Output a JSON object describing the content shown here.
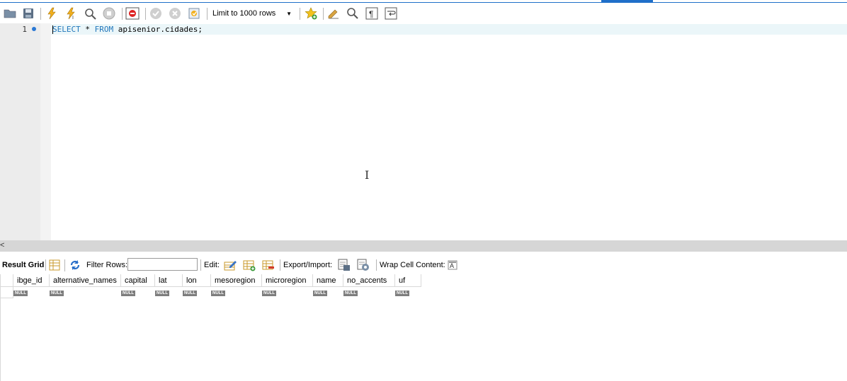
{
  "toolbar": {
    "limit_label": "Limit to 1000 rows",
    "icons": [
      "open-folder-icon",
      "save-icon",
      "execute-icon",
      "execute-current-icon",
      "explain-icon",
      "stop-icon",
      "toggle-error-icon",
      "commit-icon",
      "rollback-icon",
      "autocommit-icon",
      "bookmark-star-icon",
      "beautify-icon",
      "find-icon",
      "invisible-chars-icon",
      "wrap-lines-icon"
    ]
  },
  "editor": {
    "line_number": "1",
    "code": {
      "kw_select": "SELECT",
      "star": " * ",
      "kw_from": "FROM",
      "rest": " apisenior.cidades;"
    }
  },
  "result_toolbar": {
    "result_grid": "Result Grid",
    "filter_rows": "Filter Rows:",
    "edit": "Edit:",
    "export_import": "Export/Import:",
    "wrap_cell": "Wrap Cell Content:"
  },
  "grid": {
    "columns": [
      "ibge_id",
      "alternative_names",
      "capital",
      "lat",
      "lon",
      "mesoregion",
      "microregion",
      "name",
      "no_accents",
      "uf"
    ],
    "null_label": "NULL"
  },
  "colors": {
    "accent": "#1f6fc9",
    "keyword": "#2277bb"
  }
}
